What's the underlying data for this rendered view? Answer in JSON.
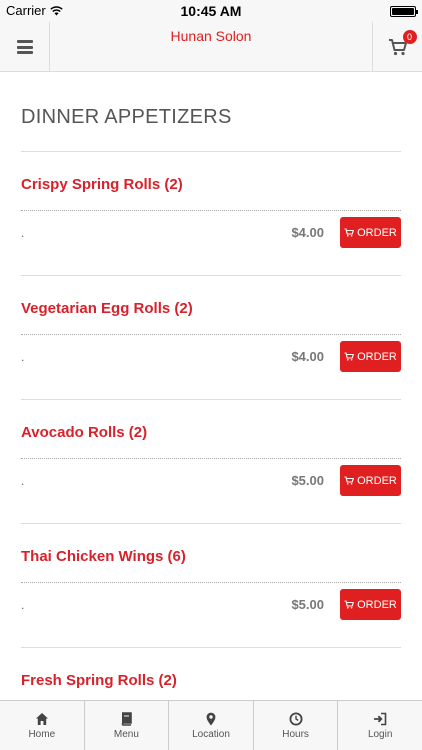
{
  "status_bar": {
    "carrier": "Carrier",
    "time": "10:45 AM"
  },
  "navbar": {
    "title": "Hunan Solon",
    "cart_count": "0"
  },
  "section": {
    "title": "DINNER APPETIZERS"
  },
  "items": [
    {
      "name": "Crispy Spring Rolls (2)",
      "desc": ".",
      "price": "$4.00",
      "order_label": "ORDER"
    },
    {
      "name": "Vegetarian Egg Rolls (2)",
      "desc": ".",
      "price": "$4.00",
      "order_label": "ORDER"
    },
    {
      "name": "Avocado Rolls (2)",
      "desc": ".",
      "price": "$5.00",
      "order_label": "ORDER"
    },
    {
      "name": "Thai Chicken Wings (6)",
      "desc": ".",
      "price": "$5.00",
      "order_label": "ORDER"
    },
    {
      "name": "Fresh Spring Rolls (2)"
    }
  ],
  "tabbar": {
    "tabs": [
      {
        "label": "Home",
        "icon": "home-icon"
      },
      {
        "label": "Menu",
        "icon": "book-icon"
      },
      {
        "label": "Location",
        "icon": "map-pin-icon"
      },
      {
        "label": "Hours",
        "icon": "clock-icon"
      },
      {
        "label": "Login",
        "icon": "login-icon"
      }
    ]
  },
  "colors": {
    "accent": "#e02020",
    "item_name": "#d8222b",
    "bar_bg": "#f7f7f7"
  }
}
